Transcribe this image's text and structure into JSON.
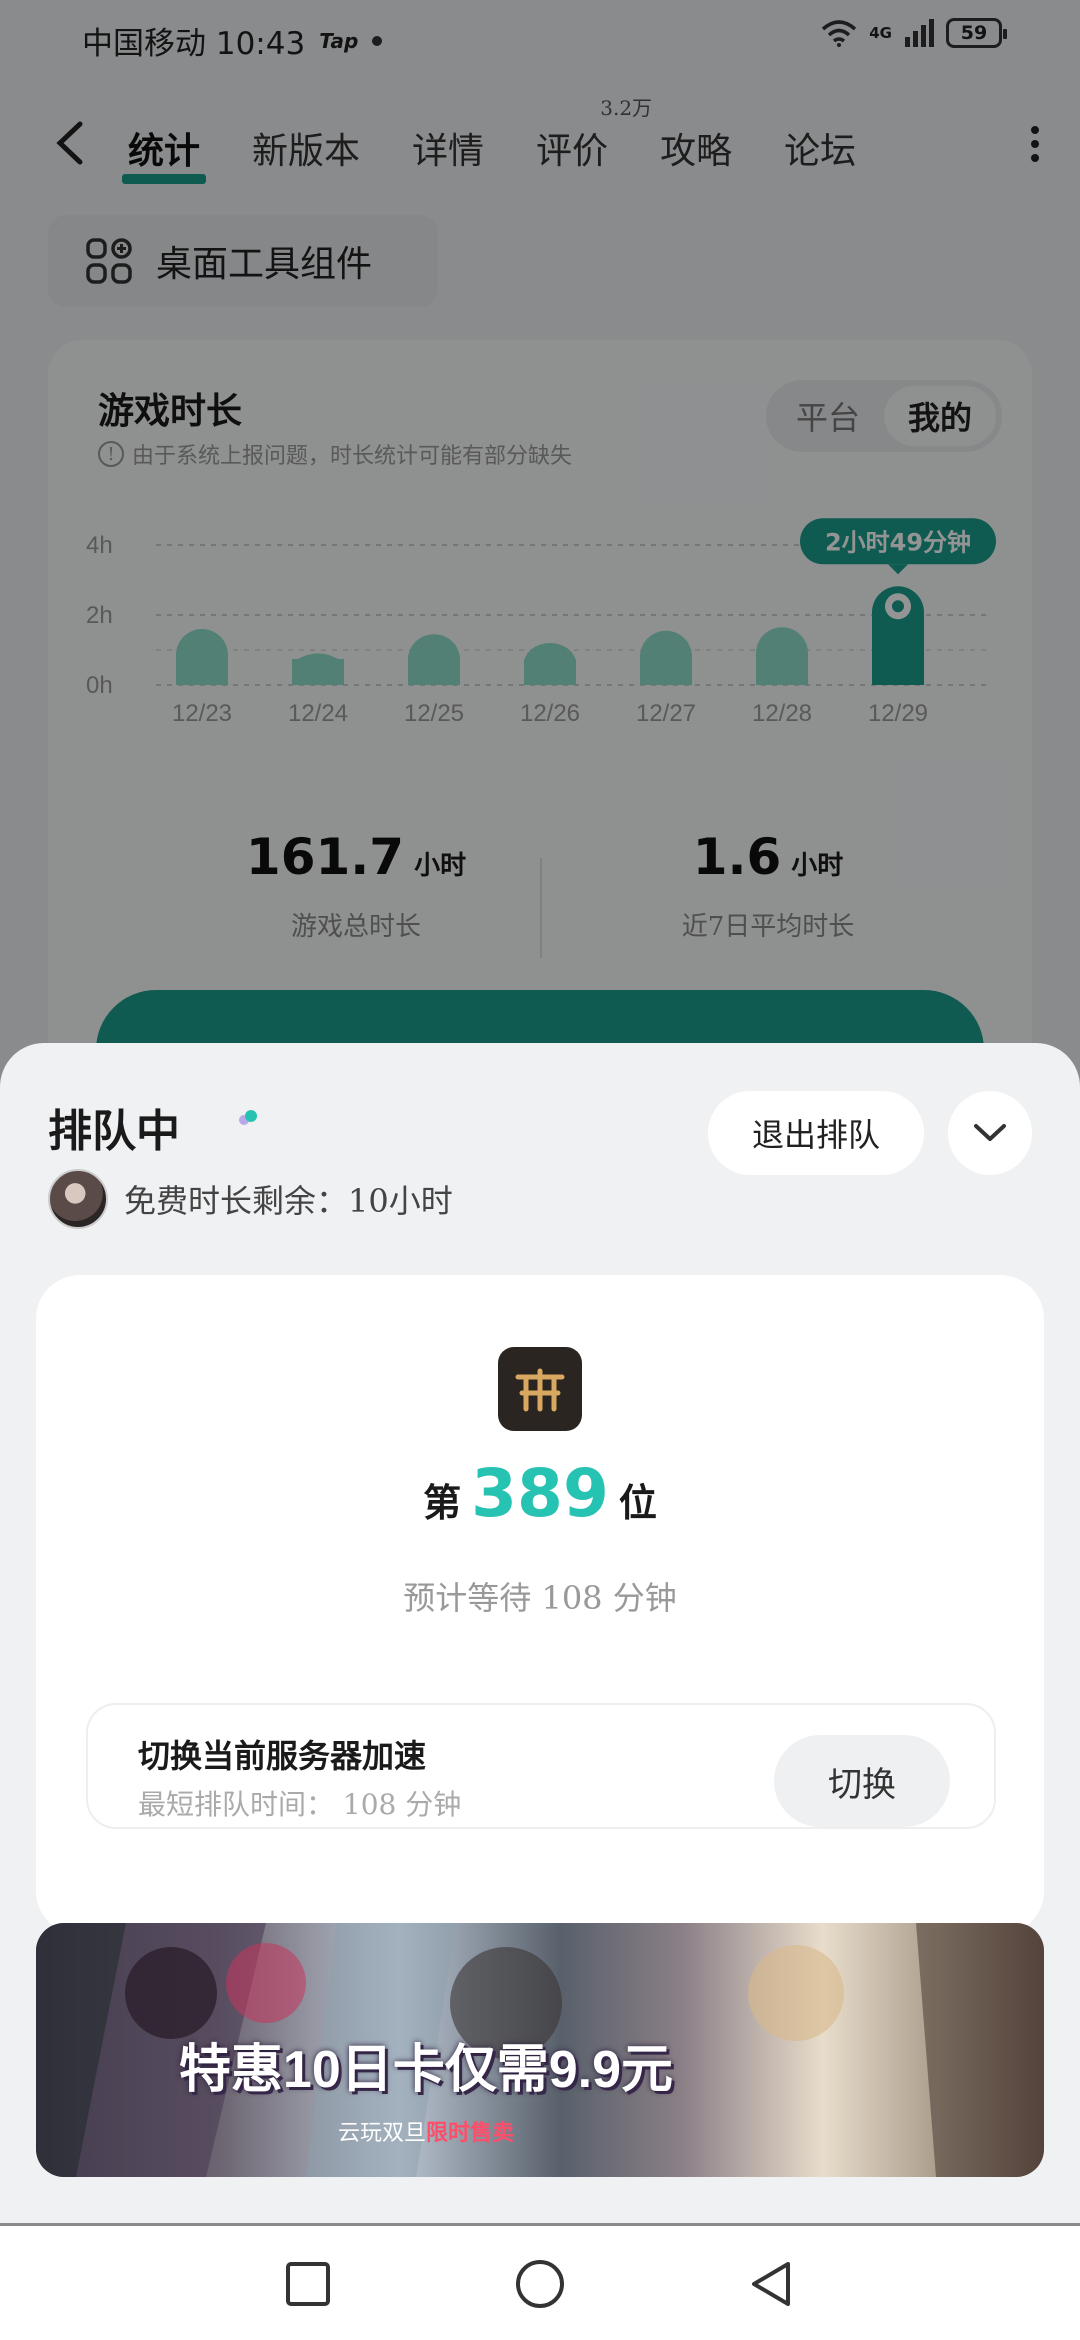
{
  "status_bar": {
    "carrier_time": "中国移动 10:43",
    "tap_label": "Tap",
    "network": "4G",
    "battery": "59"
  },
  "nav": {
    "tabs": [
      {
        "label": "统计",
        "active": true
      },
      {
        "label": "新版本"
      },
      {
        "label": "详情"
      },
      {
        "label": "评价",
        "badge": "3.2万"
      },
      {
        "label": "攻略"
      },
      {
        "label": "论坛"
      }
    ]
  },
  "widget_button": {
    "label": "桌面工具组件"
  },
  "stats": {
    "title": "游戏时长",
    "note": "由于系统上报问题，时长统计可能有部分缺失",
    "segment": {
      "options": [
        "平台",
        "我的"
      ],
      "selected": "我的"
    },
    "total_value": "161.7",
    "total_unit": "小时",
    "total_label": "游戏总时长",
    "avg_value": "1.6",
    "avg_unit": "小时",
    "avg_label": "近7日平均时长"
  },
  "chart_data": {
    "type": "bar",
    "categories": [
      "12/23",
      "12/24",
      "12/25",
      "12/26",
      "12/27",
      "12/28",
      "12/29"
    ],
    "values": [
      1.6,
      0.9,
      1.45,
      1.2,
      1.55,
      1.65,
      2.82
    ],
    "yticks": [
      "4h",
      "2h",
      "0h"
    ],
    "ylim": [
      0,
      4
    ],
    "highlight_index": 6,
    "highlight_label": "2小时49分钟",
    "grid": true,
    "bar_color": "#8fdcc9",
    "highlight_color": "#1a9e8c"
  },
  "sheet": {
    "title": "排队中",
    "free_time": "免费时长剩余：10小时",
    "exit_label": "退出排队",
    "rank_prefix": "第",
    "rank_number": "389",
    "rank_suffix": "位",
    "wait_text": "预计等待 108 分钟",
    "server_title": "切换当前服务器加速",
    "server_sub": "最短排队时间： 108 分钟",
    "switch_label": "切换",
    "banner_headline": "特惠10日卡仅需9.9元",
    "banner_sub_prefix": "云玩双旦",
    "banner_sub_highlight": "限时售卖"
  },
  "colors": {
    "accent": "#1a9e8c",
    "rank_accent": "#27c3b2",
    "banner_highlight": "#ff4e6a"
  }
}
